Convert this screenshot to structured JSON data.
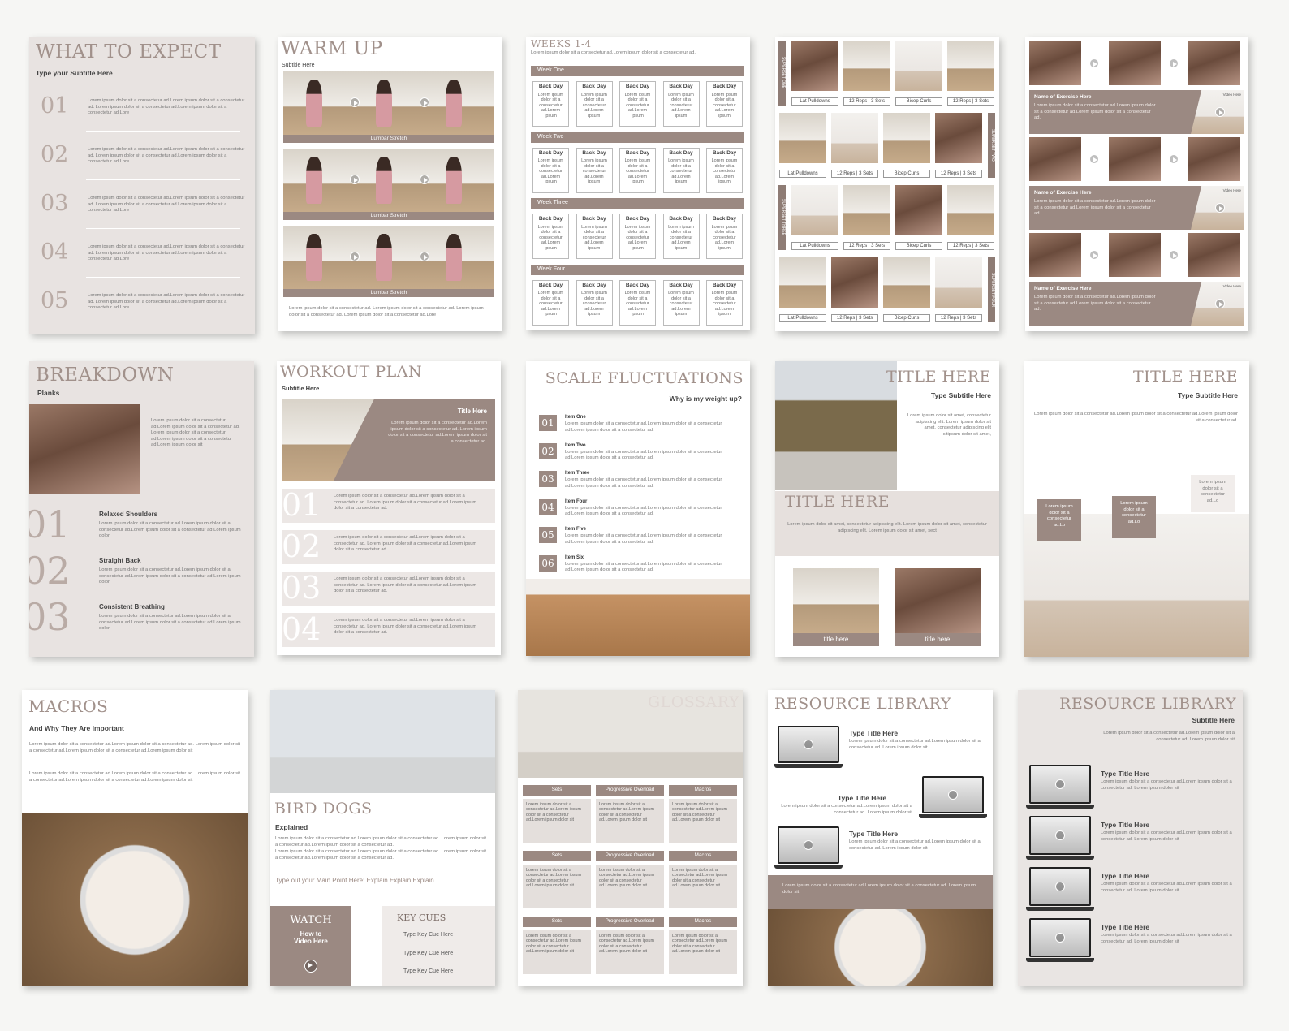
{
  "p1": {
    "title": "WHAT TO EXPECT",
    "subtitle": "Type your Subtitle Here",
    "nums": [
      "01",
      "02",
      "03",
      "04",
      "05"
    ],
    "text": "Lorem ipsum dolor sit a consectetur ad.Lorem ipsum dolor sit a consectetur ad. Lorem ipsum dolor sit a consectetur ad.Lorem ipsum dolor sit a consectetur ad.Lore"
  },
  "p2": {
    "title": "WARM UP",
    "subtitle": "Subtitle Here",
    "caption": "Lumbar Stretch",
    "text": "Lorem ipsum dolor sit a consectetur ad. Lorem ipsum dolor sit a consectetur ad. Lorem ipsum dolor sit a consectetur ad. Lorem ipsum dolor sit a consectetur ad.Lore"
  },
  "p3": {
    "title": "WEEKS 1-4",
    "weeks": [
      "Week One",
      "Week Two",
      "Week Three",
      "Week Four"
    ],
    "day": "Back Day",
    "daytext": "Lorem ipsum dolor sit a consectetur ad.Lorem ipsum",
    "text": "Lorem ipsum dolor sit a consectetur ad.Lorem ipsum dolor sit a consectetur ad."
  },
  "p4": {
    "labels": [
      "Lat Pulldowns",
      "12 Reps | 3 Sets",
      "Bicep Curls",
      "12 Reps | 3 Sets"
    ],
    "sets": [
      "SUPERSET ONE",
      "SUPERSET TWO",
      "SUPERSET THREE",
      "SUPERSET FOUR"
    ]
  },
  "p5": {
    "name": "Name of Exercise Here",
    "video": "Video Here",
    "text": "Lorem ipsum dolor sit a consectetur ad.Lorem ipsum dolor sit a consectetur ad.Lorem ipsum dolor sit a consectetur ad."
  },
  "p6": {
    "title": "BREAKDOWN",
    "subtitle": "Planks",
    "nums": [
      "01",
      "02",
      "03"
    ],
    "items": [
      "Relaxed Shoulders",
      "Straight Back",
      "Consistent Breathing"
    ],
    "intro": "Lorem ipsum dolor sit a consectetur ad.Lorem ipsum dolor sit a consectetur ad. Lorem ipsum dolor sit a consectetur ad.Lorem ipsum dolor sit a consectetur ad.Lorem ipsum dolor sit",
    "text": "Lorem ipsum dolor sit a consectetur ad.Lorem ipsum dolor sit a consectetur ad.Lorem ipsum dolor sit a consectetur ad.Lorem ipsum dolor"
  },
  "p7": {
    "title": "WORKOUT PLAN",
    "subtitle": "Subtitle Here",
    "boxtitle": "Title Here",
    "nums": [
      "01",
      "02",
      "03",
      "04"
    ],
    "text": "Lorem ipsum dolor sit a consectetur ad.Lorem ipsum dolor sit a consectetur ad. Lorem ipsum dolor sit a consectetur ad.Lorem ipsum dolor sit a consectetur ad."
  },
  "p8": {
    "title": "SCALE FLUCTUATIONS",
    "subtitle": "Why is my weight up?",
    "nums": [
      "01",
      "02",
      "03",
      "04",
      "05",
      "06"
    ],
    "items": [
      "Item One",
      "Item Two",
      "Item Three",
      "Item Four",
      "Item Five",
      "Item Six"
    ],
    "text": "Lorem ipsum dolor sit a consectetur ad.Lorem ipsum dolor sit a consectetur ad.Lorem ipsum dolor sit a consectetur ad."
  },
  "p9": {
    "title": "TITLE HERE",
    "subtitle": "Type Subtitle Here",
    "title2": "TITLE HERE",
    "caption": "title here",
    "side": "Lorem ipsum dolor sit amet, consectetur adipiscing elit. Lorem ipsum dolor sit amet, consectetur adipiscing elit sitipsum dolor sit amet,",
    "text": "Lorem ipsum dolor sit amet, consectetur adipiscing elit. Lorem ipsum dolor sit amet, consectetur adipiscing elit. Lorem ipsum dolor sit amet, sect"
  },
  "p10": {
    "title": "TITLE HERE",
    "subtitle": "Type Subtitle Here",
    "text": "Lorem ipsum dolor sit a consectetur ad.Lorem ipsum dolor sit a consectetur ad.Lorem ipsum dolor sit a consectetur ad.",
    "tag": "Lorem ipsum dolor sit a consectetur ad.Lo"
  },
  "p11": {
    "title": "MACROS",
    "subtitle": "And Why They Are Important",
    "text": "Lorem ipsum dolor sit a consectetur ad.Lorem ipsum dolor sit a consectetur ad. Lorem ipsum dolor sit a consectetur ad.Lorem ipsum dolor sit a consectetur ad.Lorem ipsum dolor sit"
  },
  "p12": {
    "title": "BIRD DOGS",
    "subtitle": "Explained",
    "main": "Type out your Main Point Here: Explain Explain Explain",
    "watch": "WATCH",
    "watchsub": "How to Video Here",
    "cues": "KEY CUES",
    "cue": "Type Key Cue Here",
    "text": "Lorem ipsum dolor sit a consectetur ad.Lorem ipsum dolor sit a consectetur ad. Lorem ipsum dolor sit a consectetur ad.Lorem ipsum dolor sit a consectetur ad."
  },
  "p13": {
    "title": "GLOSSARY",
    "heads": [
      "Sets",
      "Progressive Overload",
      "Macros"
    ],
    "text": "Lorem ipsum dolor sit a consectetur ad.Lorem ipsum dolor sit a consectetur ad.Lorem ipsum dolor sit"
  },
  "p14": {
    "title": "RESOURCE LIBRARY",
    "item": "Type Title Here",
    "text": "Lorem ipsum dolor sit a consectetur ad.Lorem ipsum dolor sit a consectetur ad. Lorem ipsum dolor sit"
  },
  "p15": {
    "title": "RESOURCE LIBRARY",
    "subtitle": "Subtitle Here",
    "item": "Type Title Here",
    "intro": "Lorem ipsum dolor sit a consectetur ad.Lorem ipsum dolor sit a consectetur ad. Lorem ipsum dolor sit",
    "text": "Lorem ipsum dolor sit a consectetur ad.Lorem ipsum dolor sit a consectetur ad. Lorem ipsum dolor sit"
  }
}
